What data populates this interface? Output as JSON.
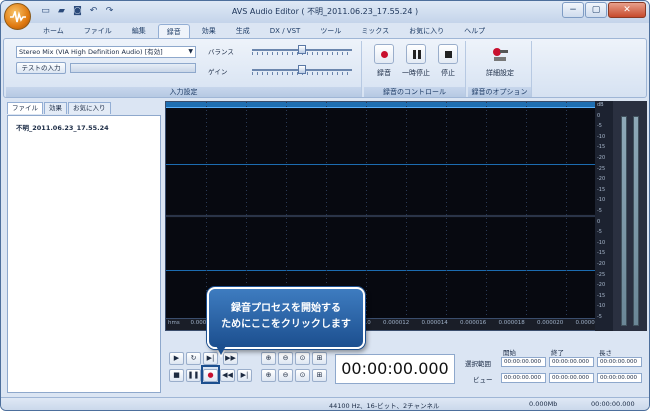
{
  "window": {
    "title": "AVS Audio Editor ( 不明_2011.06.23_17.55.24 )"
  },
  "titlebar_controls": {
    "minimize": "−",
    "maximize": "▢",
    "close": "✕"
  },
  "quick_access": [
    "new-icon",
    "open-icon",
    "save-icon",
    "undo-icon",
    "redo-icon"
  ],
  "tabs": [
    {
      "label": "ホーム"
    },
    {
      "label": "ファイル"
    },
    {
      "label": "編集"
    },
    {
      "label": "録音"
    },
    {
      "label": "効果"
    },
    {
      "label": "生成"
    },
    {
      "label": "DX / VST"
    },
    {
      "label": "ツール"
    },
    {
      "label": "ミックス"
    },
    {
      "label": "お気に入り"
    },
    {
      "label": "ヘルプ"
    }
  ],
  "active_tab": "録音",
  "input_settings": {
    "device": "Stereo Mix (VIA High Definition Audio) [有効]",
    "test_button": "テストの入力",
    "balance_label": "バランス",
    "gain_label": "ゲイン",
    "balance_level": 0.5,
    "gain_level": 0.5,
    "group_label": "入力設定"
  },
  "record_controls": {
    "record": "録音",
    "pause": "一時停止",
    "stop": "停止",
    "group_label": "録音のコントロール"
  },
  "record_options": {
    "settings": "詳細設定",
    "group_label": "録音のオプション"
  },
  "left_panel": {
    "tabs": [
      "ファイル",
      "効果",
      "お気に入り"
    ],
    "files": [
      "不明_2011.06.23_17.55.24"
    ]
  },
  "waveform": {
    "timeline": [
      "hms",
      "0.000002",
      "0.000004",
      "0.000006",
      "0.000008",
      "0.000010",
      "0.000012",
      "0.000014",
      "0.000016",
      "0.000018",
      "0.000020",
      "0.000022"
    ],
    "db_scale": [
      "dB",
      "0",
      "-5",
      "-10",
      "-15",
      "-20",
      "-25",
      "-20",
      "-15",
      "-10",
      "-5",
      "0",
      "-5",
      "-10",
      "-15",
      "-20",
      "-25",
      "-20",
      "-15",
      "-10",
      "-5"
    ]
  },
  "timecode": "00:00:00.000",
  "selection": {
    "start_header": "開始",
    "end_header": "終了",
    "length_header": "長さ",
    "selection_label": "選択範囲",
    "view_label": "ビュー",
    "selection_values": [
      "00:00:00.000",
      "00:00:00.000",
      "00:00:00.000"
    ],
    "view_values": [
      "00:00:00.000",
      "00:00:00.000",
      "00:00:00.000"
    ]
  },
  "status": {
    "format": "44100 Hz、16-ビット、2チャンネル",
    "size": "0.000Mb",
    "duration": "00:00:00.000"
  },
  "callout": {
    "line1": "録音プロセスを開始する",
    "line2": "ためにここをクリックします"
  }
}
